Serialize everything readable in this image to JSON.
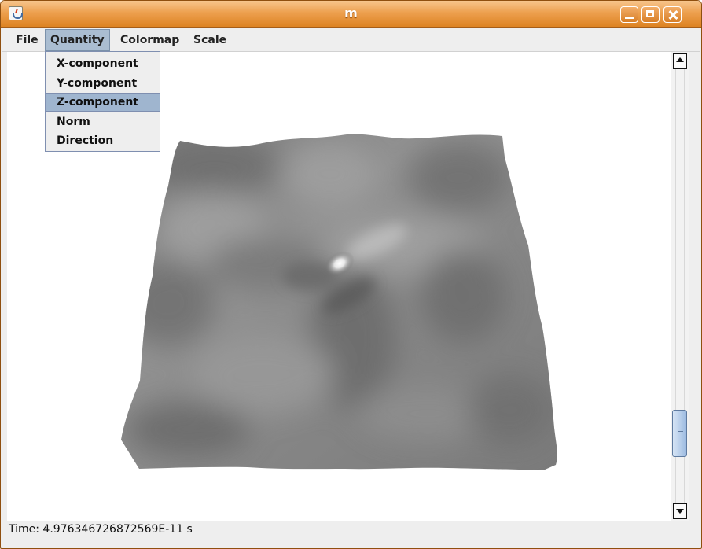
{
  "window": {
    "title": "m",
    "title_color": "#ffffff",
    "accent": "#e89a45",
    "titlebar_buttons": [
      "minimize",
      "maximize",
      "close"
    ]
  },
  "menu": {
    "items": [
      "File",
      "Quantity",
      "Colormap",
      "Scale"
    ],
    "active": "Quantity"
  },
  "quantity_menu": {
    "items": [
      "X-component",
      "Y-component",
      "Z-component",
      "Norm",
      "Direction"
    ],
    "selected": "Z-component",
    "selected_color": "#9fb5cf"
  },
  "status": {
    "time": "Time: 4.976346726872569E-11 s"
  },
  "icons": {
    "app": "java-cup-icon",
    "minimize": "minimize-icon",
    "maximize": "maximize-icon",
    "close": "close-icon",
    "scroll_up": "arrow-up-icon",
    "scroll_down": "arrow-down-icon"
  },
  "surface": {
    "shading": "gray",
    "highlight": "bright-spot"
  }
}
